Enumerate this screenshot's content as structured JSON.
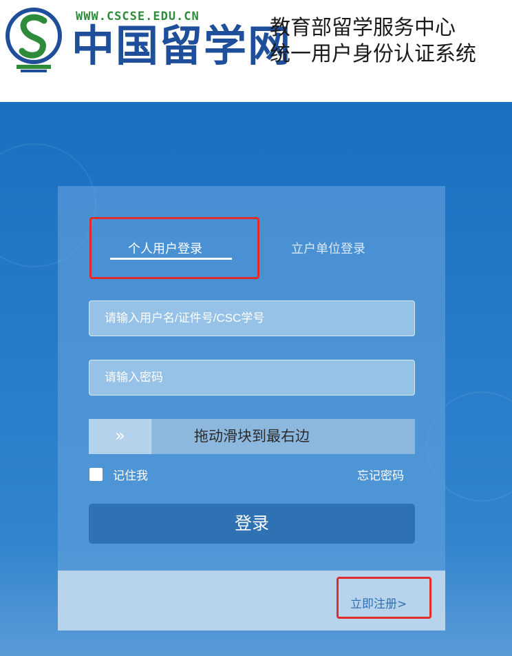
{
  "header": {
    "site_url": "WWW.CSCSE.EDU.CN",
    "site_name": "中国留学网",
    "org_line1": "教育部留学服务中心",
    "org_line2": "统一用户身份认证系统",
    "logo_icon": "cscse-s-emblem-icon",
    "colors": {
      "site_name": "#1f4f9a",
      "site_url": "#2e8b3a"
    }
  },
  "login": {
    "tabs": [
      {
        "label": "个人用户登录",
        "active": true
      },
      {
        "label": "立户单位登录",
        "active": false
      }
    ],
    "username_placeholder": "请输入用户名/证件号/CSC学号",
    "password_placeholder": "请输入密码",
    "slider_handle_icon": "double-chevron-right-icon",
    "slider_handle_glyph": "»",
    "slider_text": "拖动滑块到最右边",
    "remember_label": "记住我",
    "forgot_label": "忘记密码",
    "submit_label": "登录",
    "register_label": "立即注册>",
    "colors": {
      "background": "#1a6fc1",
      "button": "#2f72b3",
      "highlight": "#e12b2b"
    }
  }
}
